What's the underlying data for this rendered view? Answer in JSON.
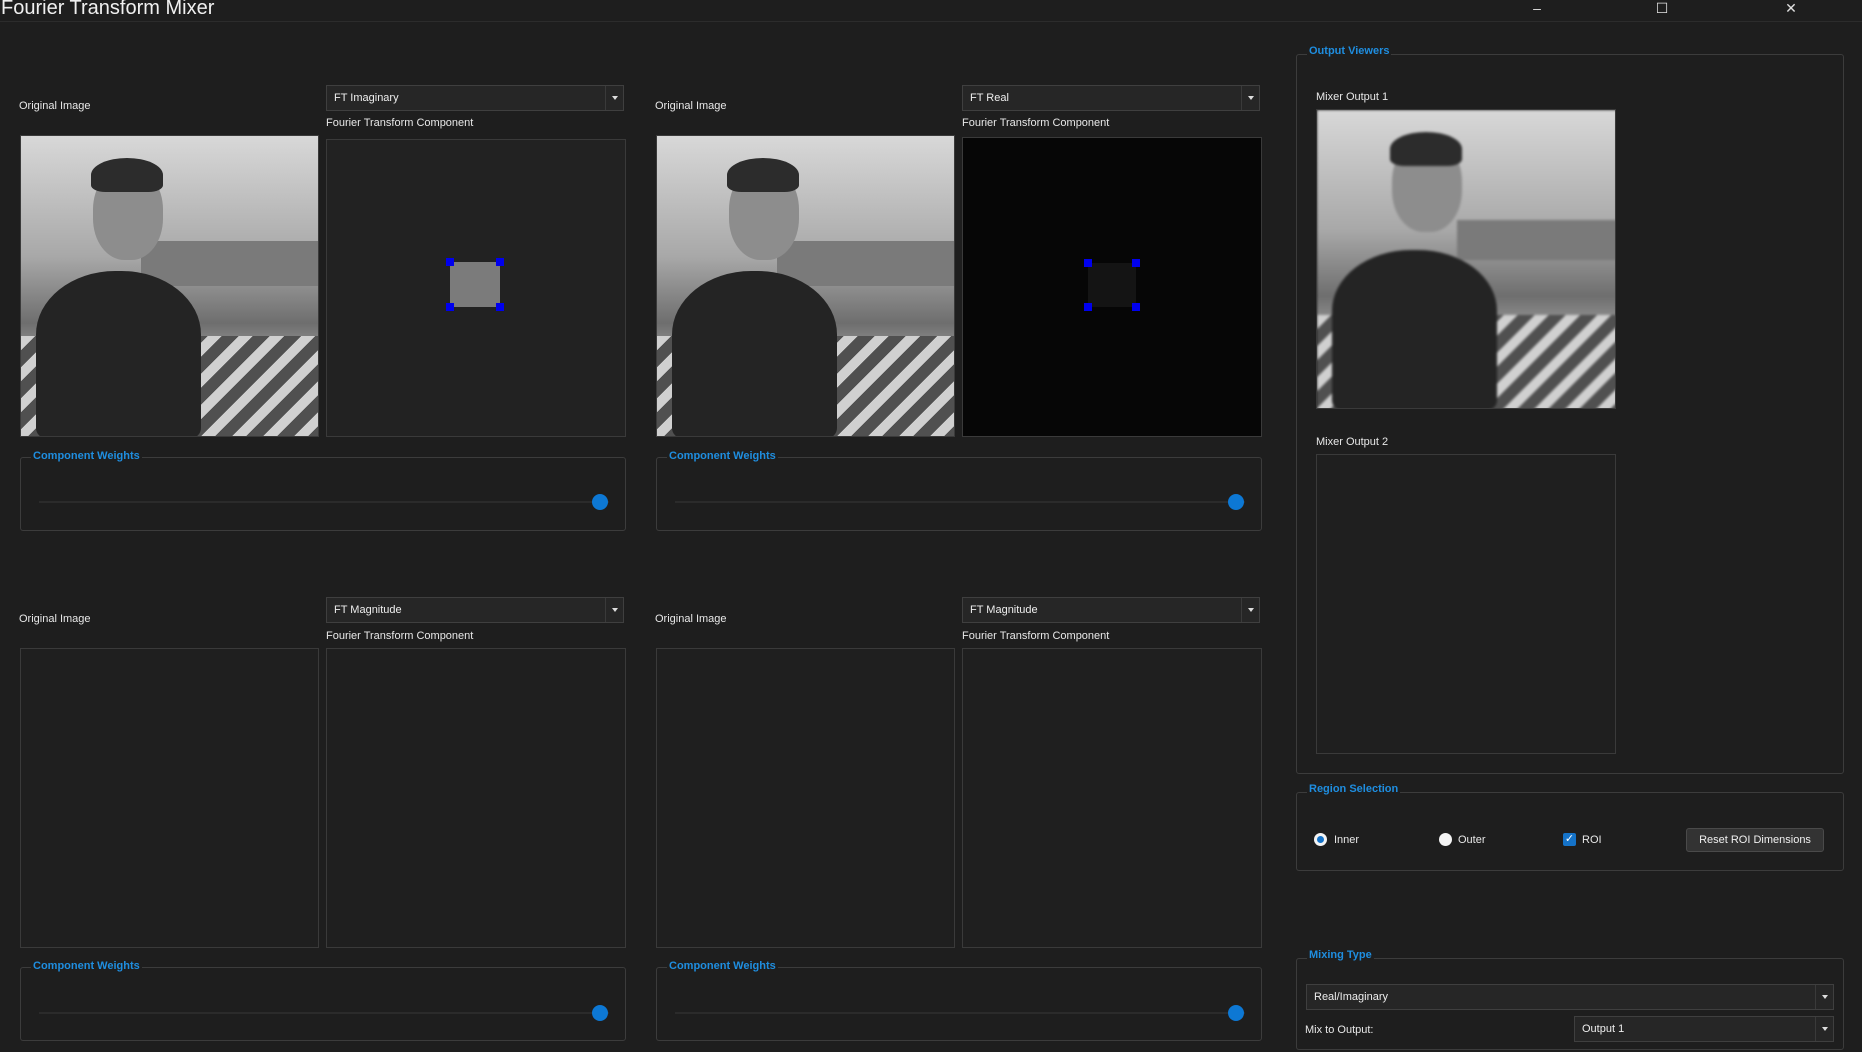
{
  "window": {
    "title": "Fourier Transform Mixer",
    "minimize": "–",
    "maximize": "☐",
    "close": "✕"
  },
  "viewers": [
    {
      "original_label": "Original Image",
      "ft_label": "Fourier Transform Component",
      "component": "FT Imaginary",
      "weights_title": "Component Weights",
      "has_image": true,
      "weight": 1.0
    },
    {
      "original_label": "Original Image",
      "ft_label": "Fourier Transform Component",
      "component": "FT Real",
      "weights_title": "Component Weights",
      "has_image": true,
      "weight": 1.0
    },
    {
      "original_label": "Original Image",
      "ft_label": "Fourier Transform Component",
      "component": "FT Magnitude",
      "weights_title": "Component Weights",
      "has_image": false,
      "weight": 1.0
    },
    {
      "original_label": "Original Image",
      "ft_label": "Fourier Transform Component",
      "component": "FT Magnitude",
      "weights_title": "Component Weights",
      "has_image": false,
      "weight": 1.0
    }
  ],
  "output_viewers": {
    "title": "Output Viewers",
    "output1_label": "Mixer Output 1",
    "output2_label": "Mixer Output 2"
  },
  "region_selection": {
    "title": "Region Selection",
    "inner_label": "Inner",
    "outer_label": "Outer",
    "roi_label": "ROI",
    "inner_checked": true,
    "outer_checked": false,
    "roi_checked": true,
    "reset_button": "Reset ROI Dimensions"
  },
  "mixing_type": {
    "title": "Mixing Type",
    "selected": "Real/Imaginary",
    "mix_to_label": "Mix to Output:",
    "output_selected": "Output 1"
  },
  "colors": {
    "accent": "#1f8ee0",
    "slider_knob": "#0d78d4",
    "roi_handle": "#0000ee",
    "background": "#1e1e1e"
  }
}
